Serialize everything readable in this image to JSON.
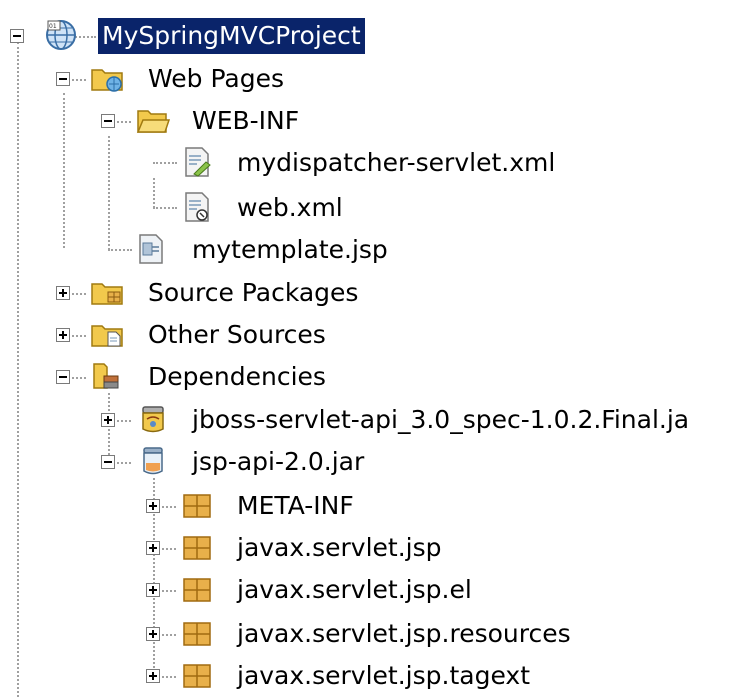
{
  "tree": {
    "root": {
      "label": "MySpringMVCProject",
      "icon": "project-globe-icon"
    },
    "web_pages": {
      "label": "Web Pages",
      "icon": "web-folder-icon"
    },
    "web_inf": {
      "label": "WEB-INF",
      "icon": "open-folder-icon"
    },
    "dispatcher": {
      "label": "mydispatcher-servlet.xml",
      "icon": "xml-config-icon"
    },
    "web_xml": {
      "label": "web.xml",
      "icon": "xml-descriptor-icon"
    },
    "template": {
      "label": "mytemplate.jsp",
      "icon": "jsp-file-icon"
    },
    "source_packages": {
      "label": "Source Packages",
      "icon": "package-folder-icon"
    },
    "other_sources": {
      "label": "Other Sources",
      "icon": "sources-folder-icon"
    },
    "dependencies": {
      "label": "Dependencies",
      "icon": "library-folder-icon"
    },
    "jboss_jar": {
      "label": "jboss-servlet-api_3.0_spec-1.0.2.Final.ja",
      "icon": "jar-icon"
    },
    "jsp_api_jar": {
      "label": "jsp-api-2.0.jar",
      "icon": "jar-open-icon"
    },
    "packages": [
      {
        "label": "META-INF"
      },
      {
        "label": "javax.servlet.jsp"
      },
      {
        "label": "javax.servlet.jsp.el"
      },
      {
        "label": "javax.servlet.jsp.resources"
      },
      {
        "label": "javax.servlet.jsp.tagext"
      }
    ]
  },
  "colors": {
    "selection": "#0a246a",
    "folder": "#f2c94c",
    "package": "#e8b04a"
  }
}
